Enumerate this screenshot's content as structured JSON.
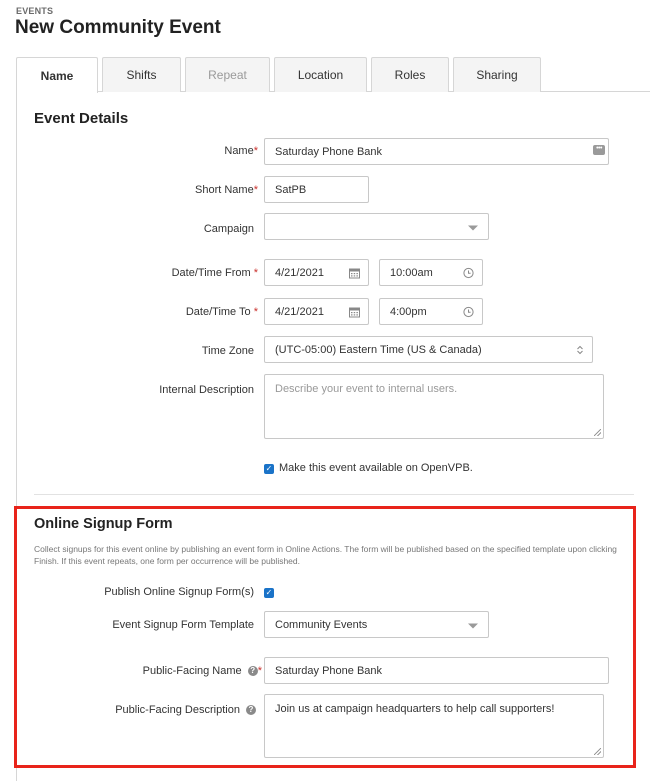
{
  "header": {
    "breadcrumb": "EVENTS",
    "title": "New Community Event"
  },
  "tabs": [
    {
      "label": "Name",
      "active": true
    },
    {
      "label": "Shifts"
    },
    {
      "label": "Repeat",
      "disabled": true
    },
    {
      "label": "Location"
    },
    {
      "label": "Roles"
    },
    {
      "label": "Sharing"
    }
  ],
  "event_details": {
    "title": "Event Details",
    "name_label": "Name",
    "name_value": "Saturday Phone Bank",
    "short_name_label": "Short Name",
    "short_name_value": "SatPB",
    "campaign_label": "Campaign",
    "campaign_value": "",
    "from_label": "Date/Time From",
    "from_date": "4/21/2021",
    "from_time": "10:00am",
    "to_label": "Date/Time To",
    "to_date": "4/21/2021",
    "to_time": "4:00pm",
    "timezone_label": "Time Zone",
    "timezone_value": "(UTC-05:00) Eastern Time (US & Canada)",
    "internal_desc_label": "Internal Description",
    "internal_desc_placeholder": "Describe your event to internal users.",
    "openvpb_label": "Make this event available on OpenVPB.",
    "openvpb_checked": true
  },
  "signup_form": {
    "title": "Online Signup Form",
    "description": "Collect signups for this event online by publishing an event form in Online Actions. The form will be published based on the specified template upon clicking Finish. If this event repeats, one form per occurrence will be published.",
    "publish_label": "Publish Online Signup Form(s)",
    "publish_checked": true,
    "template_label": "Event Signup Form Template",
    "template_value": "Community Events",
    "public_name_label": "Public-Facing Name",
    "public_name_value": "Saturday Phone Bank",
    "public_desc_label": "Public-Facing Description",
    "public_desc_value": "Join us at campaign headquarters to help call supporters!"
  },
  "colors": {
    "highlight": "#e8231a",
    "checkbox": "#1a73c8",
    "required": "#c9302c"
  }
}
